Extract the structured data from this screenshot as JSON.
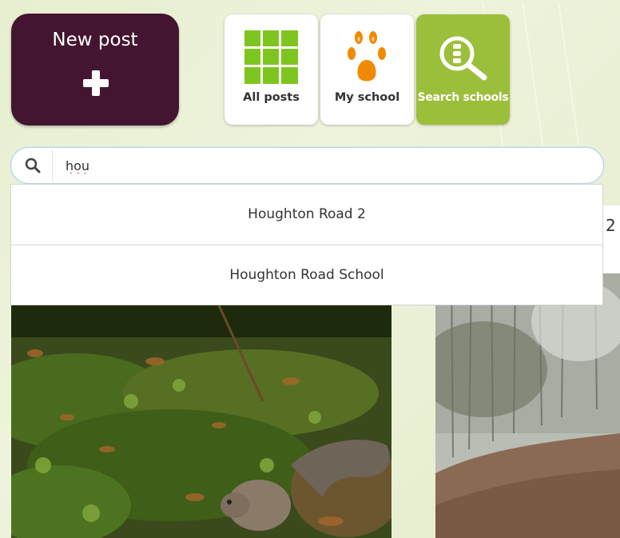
{
  "new_post": {
    "label": "New post",
    "icon": "plus-icon"
  },
  "nav": {
    "tiles": [
      {
        "label": "All posts",
        "icon": "grid-icon",
        "active": false
      },
      {
        "label": "My school",
        "icon": "paw-print-icon",
        "active": false
      },
      {
        "label": "Search schools",
        "icon": "magnifier-school-icon",
        "active": true
      }
    ]
  },
  "search": {
    "value": "hou",
    "icon": "search-icon",
    "suggestions": [
      {
        "label": "Houghton Road 2"
      },
      {
        "label": "Houghton Road School"
      }
    ]
  },
  "posts": {
    "partial_text": "2",
    "images": [
      {
        "description_icon": "squirrel-photo"
      },
      {
        "description_icon": "misty-forest-photo"
      }
    ]
  },
  "colors": {
    "new_post_bg": "#441530",
    "active_tile": "#9cbf3b",
    "grid_icon": "#7ec61f",
    "paw_icon": "#f08a00"
  }
}
